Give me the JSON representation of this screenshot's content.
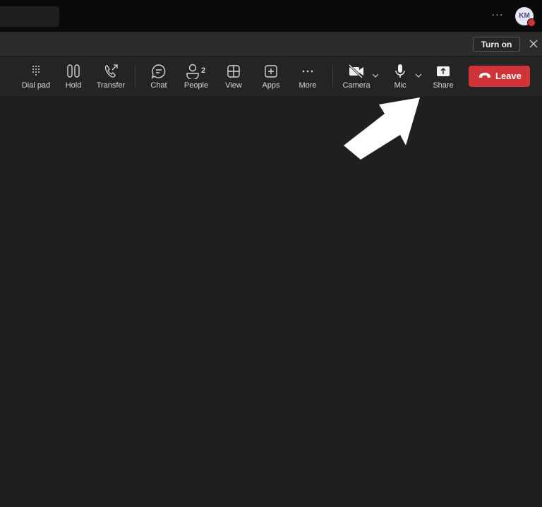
{
  "titlebar": {
    "more_label": "···",
    "avatar_initials": "KM",
    "avatar_status_color": "#d13438"
  },
  "banner": {
    "turn_on_label": "Turn on",
    "close_icon": "close-icon"
  },
  "toolbar": {
    "buttons": [
      {
        "id": "dial-pad",
        "label": "Dial pad",
        "icon": "dialpad-icon"
      },
      {
        "id": "hold",
        "label": "Hold",
        "icon": "pause-icon"
      },
      {
        "id": "transfer",
        "label": "Transfer",
        "icon": "phone-transfer-icon"
      },
      {
        "id": "chat",
        "label": "Chat",
        "icon": "chat-bubble-icon"
      },
      {
        "id": "people",
        "label": "People",
        "icon": "person-icon",
        "count": "2"
      },
      {
        "id": "view",
        "label": "View",
        "icon": "grid-icon"
      },
      {
        "id": "apps",
        "label": "Apps",
        "icon": "plus-square-icon"
      },
      {
        "id": "more",
        "label": "More",
        "icon": "more-icon"
      },
      {
        "id": "camera",
        "label": "Camera",
        "icon": "camera-off-icon"
      },
      {
        "id": "mic",
        "label": "Mic",
        "icon": "mic-icon"
      },
      {
        "id": "share",
        "label": "Share",
        "icon": "share-screen-icon"
      }
    ],
    "leave_label": "Leave",
    "leave_color": "#d13438"
  },
  "annotation": {
    "arrow_icon": "pointer-arrow-icon",
    "arrow_color": "#ffffff"
  }
}
